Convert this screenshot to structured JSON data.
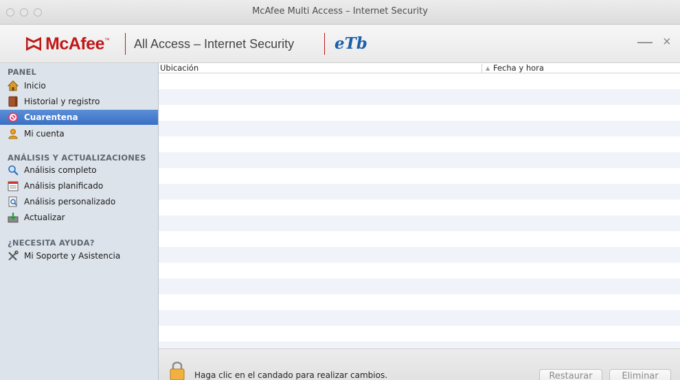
{
  "window": {
    "title": "McAfee Multi Access – Internet Security",
    "close_glyph": "×",
    "minimize_glyph": "—"
  },
  "brand": {
    "logo_text": "McAfee",
    "logo_tm": "™",
    "product_name": "All Access – Internet Security",
    "partner_logo": "eTb",
    "brand_color": "#c01818",
    "partner_color": "#1d5fa8"
  },
  "sidebar": {
    "sections": [
      {
        "title": "PANEL",
        "items": [
          {
            "label": "Inicio",
            "icon": "home-icon",
            "selected": false
          },
          {
            "label": "Historial y registro",
            "icon": "history-book-icon",
            "selected": false
          },
          {
            "label": "Cuarentena",
            "icon": "quarantine-prohibited-icon",
            "selected": true
          },
          {
            "label": "Mi cuenta",
            "icon": "account-user-icon",
            "selected": false
          }
        ]
      },
      {
        "title": "ANÁLISIS Y ACTUALIZACIONES",
        "items": [
          {
            "label": "Análisis completo",
            "icon": "magnifier-icon",
            "selected": false
          },
          {
            "label": "Análisis planificado",
            "icon": "scheduled-calendar-icon",
            "selected": false
          },
          {
            "label": "Análisis personalizado",
            "icon": "custom-scan-icon",
            "selected": false
          },
          {
            "label": "Actualizar",
            "icon": "update-download-icon",
            "selected": false
          }
        ]
      },
      {
        "title": "¿NECESITA AYUDA?",
        "items": [
          {
            "label": "Mi Soporte y Asistencia",
            "icon": "tools-icon",
            "selected": false
          }
        ]
      }
    ],
    "selected_color": "#3a6fc4"
  },
  "table": {
    "columns": [
      "Ubicación",
      "Fecha y hora"
    ],
    "rows": []
  },
  "footer": {
    "lock_message": "Haga clic en el candado para realizar cambios.",
    "restore_label": "Restaurar",
    "delete_label": "Eliminar"
  }
}
